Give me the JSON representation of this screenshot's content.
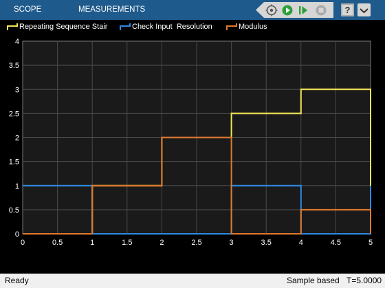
{
  "toolstrip": {
    "tabs": [
      {
        "label": "SCOPE"
      },
      {
        "label": "MEASUREMENTS"
      }
    ],
    "icons": [
      "step-back-icon",
      "run-icon",
      "step-forward-icon",
      "stop-icon",
      "help-icon",
      "expand-icon"
    ]
  },
  "colors": {
    "background": "#000000",
    "plot_area": "#1a1a1a",
    "grid": "#4a4a4a",
    "axis_text": "#ffffff",
    "toolstrip": "#1f5a8c",
    "run_green": "#2e9e3a",
    "series": [
      "#f5e556",
      "#2f8ae5",
      "#e07a2e"
    ]
  },
  "chart_data": {
    "type": "line",
    "step": true,
    "title": "",
    "xlabel": "",
    "ylabel": "",
    "xlim": [
      0,
      5
    ],
    "ylim": [
      0,
      4
    ],
    "grid": true,
    "legend_placement": "top",
    "xticks": [
      "0",
      "0.5",
      "1",
      "1.5",
      "2",
      "2.5",
      "3",
      "3.5",
      "4",
      "4.5",
      "5"
    ],
    "yticks": [
      "0",
      "0.5",
      "1",
      "1.5",
      "2",
      "2.5",
      "3",
      "3.5",
      "4"
    ],
    "series": [
      {
        "name": "Repeating Sequence Stair",
        "color": "#f5e556",
        "points": [
          [
            0,
            0
          ],
          [
            1,
            0
          ],
          [
            1,
            1
          ],
          [
            2,
            1
          ],
          [
            2,
            2
          ],
          [
            3,
            2
          ],
          [
            3,
            2.5
          ],
          [
            4,
            2.5
          ],
          [
            4,
            3
          ],
          [
            5,
            3
          ],
          [
            5,
            0
          ]
        ]
      },
      {
        "name": "Check Input  Resolution",
        "color": "#2f8ae5",
        "points": [
          [
            0,
            1
          ],
          [
            1,
            1
          ],
          [
            1,
            0
          ],
          [
            3,
            0
          ],
          [
            3,
            1
          ],
          [
            4,
            1
          ],
          [
            4,
            0
          ],
          [
            5,
            0
          ],
          [
            5,
            1
          ]
        ]
      },
      {
        "name": "Modulus",
        "color": "#e07a2e",
        "points": [
          [
            0,
            0
          ],
          [
            1,
            0
          ],
          [
            1,
            1
          ],
          [
            2,
            1
          ],
          [
            2,
            2
          ],
          [
            3,
            2
          ],
          [
            3,
            0
          ],
          [
            4,
            0
          ],
          [
            4,
            0.5
          ],
          [
            5,
            0.5
          ],
          [
            5,
            0
          ]
        ]
      }
    ]
  },
  "statusbar": {
    "state": "Ready",
    "mode": "Sample based",
    "time": "T=5.0000"
  }
}
